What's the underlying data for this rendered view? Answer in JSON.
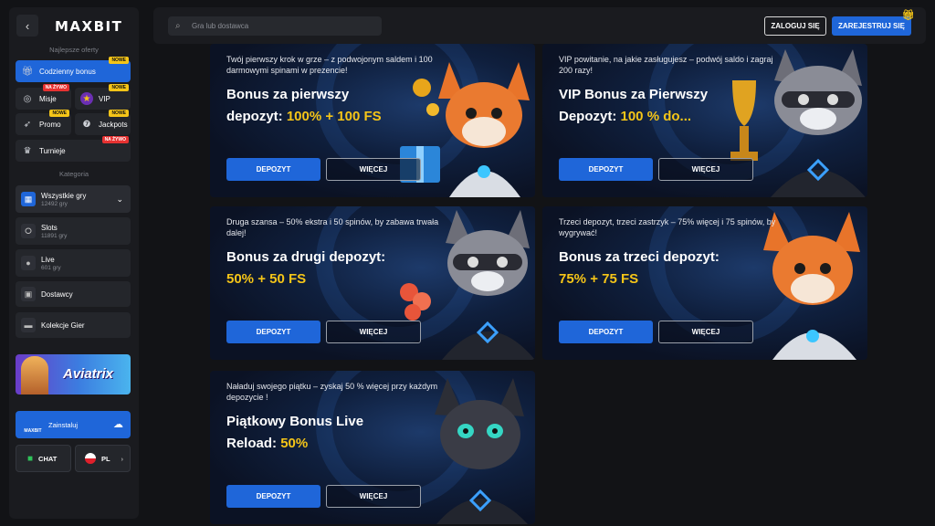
{
  "app": {
    "logo": "MAXBIT"
  },
  "sidebar": {
    "back_icon": "arrow-left-icon",
    "section_offers": "Najlepsze oferty",
    "daily_bonus": {
      "label": "Codzienny bonus",
      "badge": "NOWE"
    },
    "missions": {
      "label": "Misje",
      "badge": "NA ŻYWO"
    },
    "vip": {
      "label": "VIP",
      "badge": "NOWE"
    },
    "promo": {
      "label": "Promo",
      "badge": "NOWE"
    },
    "jackpots": {
      "label": "Jackpots",
      "badge": "NOWE"
    },
    "tournaments": {
      "label": "Turnieje",
      "badge": "NA ŻYWO"
    },
    "section_category": "Kategoria",
    "categories": [
      {
        "label": "Wszystkie gry",
        "count": "12492 gry"
      },
      {
        "label": "Slots",
        "count": "11891 gry"
      },
      {
        "label": "Live",
        "count": "601 gry"
      },
      {
        "label": "Dostawcy",
        "count": ""
      },
      {
        "label": "Kolekcje Gier",
        "count": ""
      }
    ],
    "banner_text": "Aviatrix",
    "install_label": "Zainstaluj",
    "install_logo": "MAXBIT",
    "chat_label": "CHAT",
    "lang_label": "PL"
  },
  "topbar": {
    "search_placeholder": "Gra lub dostawca",
    "login_label": "ZALOGUJ SIĘ",
    "register_label": "ZAREJESTRUJ SIĘ"
  },
  "bonuses": [
    {
      "desc": "Twój pierwszy krok w grze – z podwojonym saldem i 100 darmowymi spinami w prezencie!",
      "title_line1": "Bonus za pierwszy",
      "title_line2": "depozyt: ",
      "highlight": "100% + 100 FS",
      "deposit": "DEPOZYT",
      "more": "WIĘCEJ"
    },
    {
      "desc": "VIP powitanie, na jakie zasługujesz – podwój saldo i zagraj 200 razy!",
      "title_line1": "VIP Bonus za Pierwszy",
      "title_line2": "Depozyt: ",
      "highlight": "100 % do...",
      "deposit": "DEPOZYT",
      "more": "WIĘCEJ"
    },
    {
      "desc": "Druga szansa – 50% ekstra i 50 spinów, by zabawa trwała dalej!",
      "title_line1": "Bonus za drugi depozyt:",
      "title_line2": "",
      "highlight": "50% + 50 FS",
      "deposit": "DEPOZYT",
      "more": "WIĘCEJ"
    },
    {
      "desc": "Trzeci depozyt, trzeci zastrzyk – 75% więcej i 75 spinów, by wygrywać!",
      "title_line1": "Bonus za trzeci depozyt:",
      "title_line2": "",
      "highlight": "75% + 75 FS",
      "deposit": "DEPOZYT",
      "more": "WIĘCEJ"
    },
    {
      "desc": "Naładuj swojego piątku – zyskaj 50 % więcej przy każdym depozycie !",
      "title_line1": "Piątkowy Bonus Live",
      "title_line2": "Reload: ",
      "highlight": "50%",
      "deposit": "DEPOZYT",
      "more": "WIĘCEJ"
    }
  ],
  "colors": {
    "accent": "#1f66d9",
    "highlight": "#f5c518",
    "bg": "#121316",
    "panel": "#1a1b1f"
  }
}
